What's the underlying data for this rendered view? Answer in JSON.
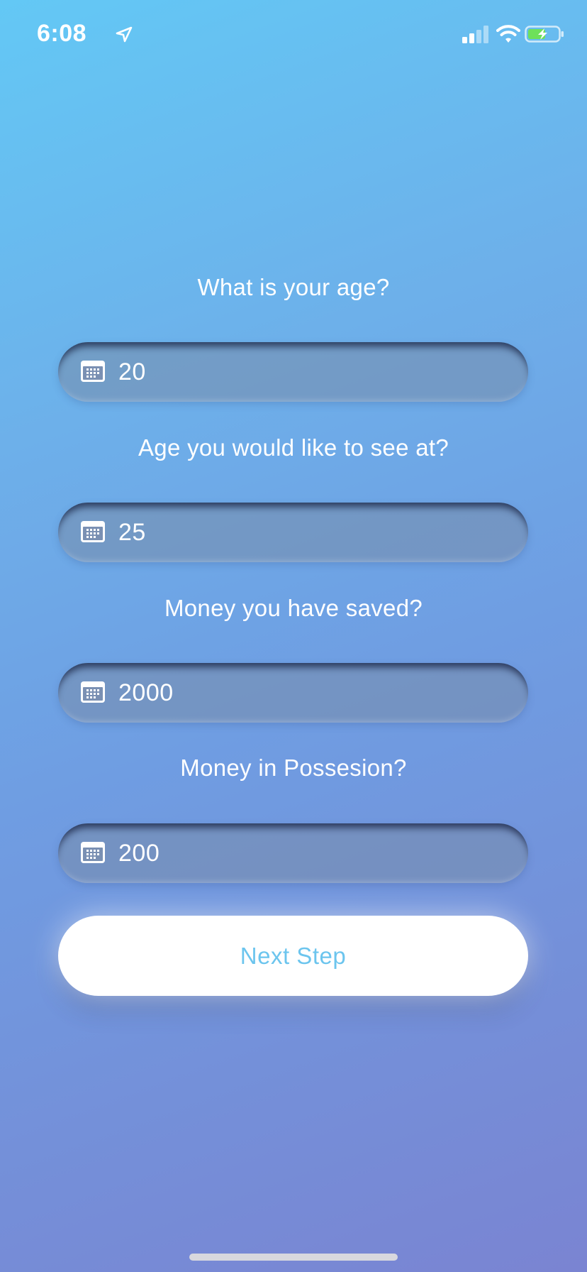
{
  "status_bar": {
    "time": "6:08",
    "icons": [
      "location-arrow-icon",
      "cellular-signal-icon",
      "wifi-icon",
      "battery-charging-icon"
    ]
  },
  "form": {
    "fields": [
      {
        "question": "What is your age?",
        "value": "20",
        "icon": "calendar-icon"
      },
      {
        "question": "Age you would like to see at?",
        "value": "25",
        "icon": "calendar-icon"
      },
      {
        "question": "Money you have saved?",
        "value": "2000",
        "icon": "calendar-icon"
      },
      {
        "question": "Money in Possesion?",
        "value": "200",
        "icon": "calendar-icon"
      }
    ],
    "next_button_label": "Next Step"
  },
  "colors": {
    "gradient_top": "#63c8f5",
    "gradient_bottom": "#7a84d2",
    "button_text": "#6cc5ee",
    "battery_fill": "#6ee05a"
  }
}
